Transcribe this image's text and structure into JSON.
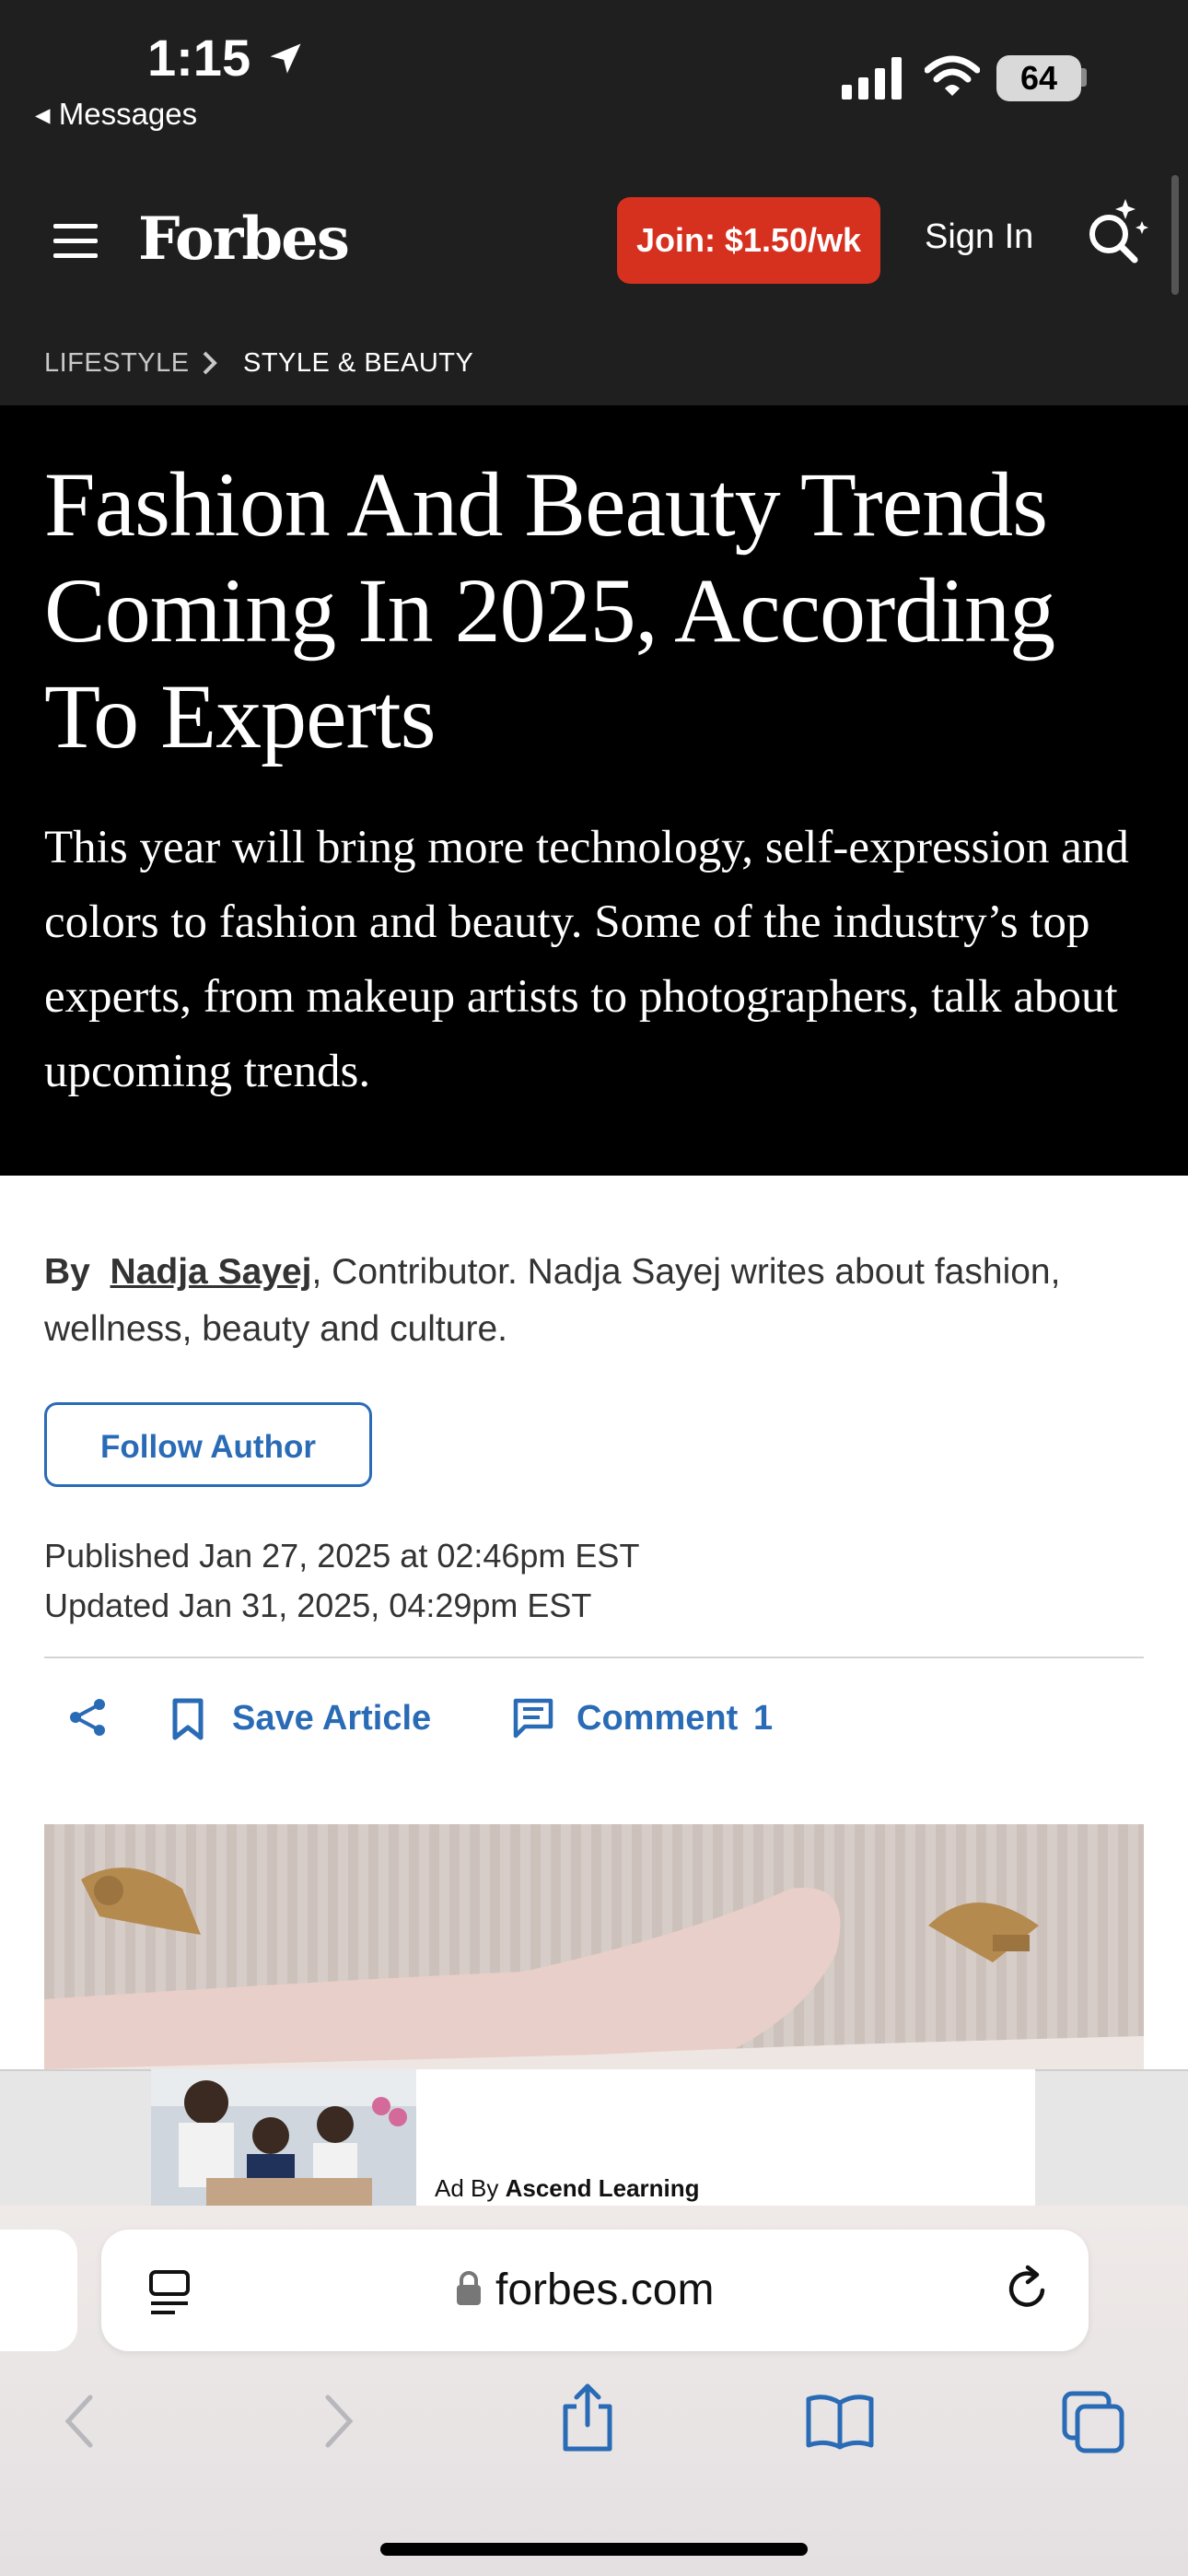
{
  "status_bar": {
    "time": "1:15",
    "back_label": "◂ Messages",
    "battery": "64"
  },
  "header": {
    "logo": "Forbes",
    "join_label": "Join: $1.50/wk",
    "signin_label": "Sign In"
  },
  "breadcrumb": {
    "section": "LIFESTYLE",
    "subsection": "STYLE & BEAUTY"
  },
  "article": {
    "headline": "Fashion And Beauty Trends Coming In 2025, According To Experts",
    "dek": "This year will bring more technology, self-expression and colors to fashion and beauty. Some of the industry’s top experts, from makeup artists to photographers, talk about upcoming trends.",
    "by_label": "By",
    "author": "Nadja Sayej",
    "author_desc": ", Contributor. Nadja Sayej writes about fashion, wellness, beauty and culture.",
    "follow_label": "Follow Author",
    "published": "Published Jan 27, 2025 at 02:46pm EST",
    "updated": "Updated Jan 31, 2025, 04:29pm EST"
  },
  "actions": {
    "save_label": "Save Article",
    "comment_label": "Comment",
    "comment_count": "1"
  },
  "ad": {
    "prefix": "Ad By ",
    "advertiser": "Ascend Learning"
  },
  "browser": {
    "url": "forbes.com"
  },
  "colors": {
    "accent_blue": "#2a6bb6",
    "join_red": "#d6301f",
    "header_bg": "#1f1f1f",
    "hero_bg": "#000000"
  }
}
